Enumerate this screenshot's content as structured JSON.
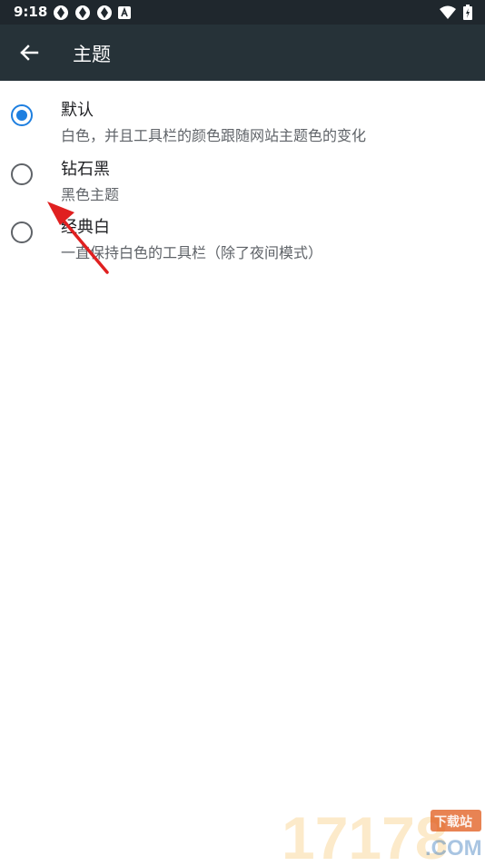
{
  "status_bar": {
    "time": "9:18",
    "left_icons": [
      "aperture-icon",
      "aperture-icon",
      "aperture-icon",
      "a-badge-icon"
    ],
    "right_icons": [
      "wifi-icon",
      "battery-icon"
    ]
  },
  "app_bar": {
    "back_icon": "arrow-left-icon",
    "title": "主题"
  },
  "options": [
    {
      "title": "默认",
      "subtitle": "白色，并且工具栏的颜色跟随网站主题色的变化",
      "selected": true
    },
    {
      "title": "钻石黑",
      "subtitle": "黑色主题",
      "selected": false
    },
    {
      "title": "经典白",
      "subtitle": "一直保持白色的工具栏（除了夜间模式）",
      "selected": false
    }
  ],
  "colors": {
    "status_bar_bg": "#1f272d",
    "app_bar_bg": "#263238",
    "accent": "#1e7fe0",
    "annotation_arrow": "#e02020"
  },
  "watermark": {
    "number": "17178",
    "badge": "下载站",
    "suffix": ".COM"
  }
}
